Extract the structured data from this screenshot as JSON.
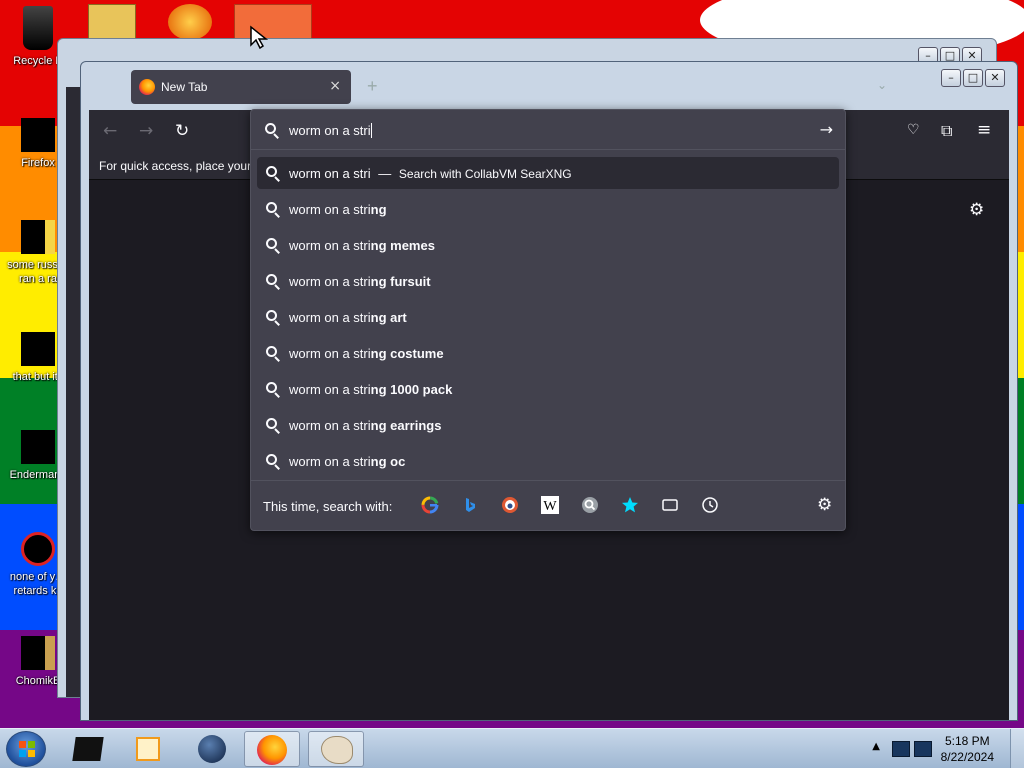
{
  "desktop": {
    "icons": [
      {
        "label": "Recycle B",
        "icon": "recycle-bin-icon"
      },
      {
        "label": "Firefox",
        "icon": "firefox-icon"
      },
      {
        "label": "some russ… ran a ra",
        "icon": "document-icon"
      },
      {
        "label": "that but its",
        "icon": "folder-icon"
      },
      {
        "label": "Endermane",
        "icon": "app-icon"
      },
      {
        "label": "none of y… retards kn",
        "icon": "app-icon"
      },
      {
        "label": "ChomikB",
        "icon": "app-icon"
      }
    ]
  },
  "browser": {
    "tab_title": "New Tab",
    "tab_close": "×",
    "new_tab": "+",
    "bookmarks_hint": "For quick access, place your b"
  },
  "urlbar": {
    "input_value": "worm on a stri",
    "heuristic": {
      "query": "worm on a stri",
      "separator": "—",
      "action": "Search with CollabVM SearXNG"
    },
    "suggestions": [
      {
        "typed": "worm on a stri",
        "completion": "ng"
      },
      {
        "typed": "worm on a stri",
        "completion": "ng memes"
      },
      {
        "typed": "worm on a stri",
        "completion": "ng fursuit"
      },
      {
        "typed": "worm on a stri",
        "completion": "ng art"
      },
      {
        "typed": "worm on a stri",
        "completion": "ng costume"
      },
      {
        "typed": "worm on a stri",
        "completion": "ng 1000 pack"
      },
      {
        "typed": "worm on a stri",
        "completion": "ng earrings"
      },
      {
        "typed": "worm on a stri",
        "completion": "ng oc"
      }
    ],
    "footer_label": "This time, search with:",
    "engines": [
      "google-icon",
      "bing-icon",
      "duckduckgo-icon",
      "wikipedia-icon",
      "searxng-icon",
      "bookmarks-icon",
      "tabs-icon",
      "history-icon"
    ]
  },
  "taskbar": {
    "time": "5:18 PM",
    "date": "8/22/2024"
  },
  "colors": {
    "panel": "#42414d",
    "text": "#fbfbfe",
    "accent": "#00ddff"
  }
}
